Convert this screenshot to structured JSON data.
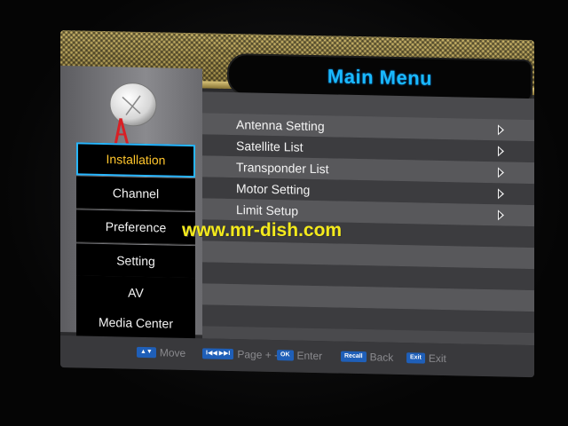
{
  "header": {
    "title": "Main Menu"
  },
  "sidebar": {
    "items": [
      {
        "label": "Installation",
        "active": true
      },
      {
        "label": "Channel"
      },
      {
        "label": "Preference"
      },
      {
        "label": "Setting"
      },
      {
        "label": "AV"
      },
      {
        "label": "Media Center"
      }
    ]
  },
  "submenu": {
    "items": [
      {
        "label": "Antenna Setting"
      },
      {
        "label": "Satellite List"
      },
      {
        "label": "Transponder List"
      },
      {
        "label": "Motor Setting"
      },
      {
        "label": "Limit Setup"
      }
    ]
  },
  "footer": {
    "hints": [
      {
        "key": "▲▼",
        "label": "Move"
      },
      {
        "key": "I◀◀ ▶▶I",
        "label": "Page + -"
      },
      {
        "key": "OK",
        "label": "Enter"
      },
      {
        "key": "Recall",
        "label": "Back"
      },
      {
        "key": "Exit",
        "label": "Exit"
      }
    ]
  },
  "watermark": "www.mr-dish.com",
  "colors": {
    "title": "#19b9ff",
    "active_item": "#ffc52c",
    "focus_border": "#27b6ff",
    "watermark": "#f4ea1c",
    "key_button": "#1f5fb8"
  },
  "icons": {
    "dish": "satellite-dish-icon",
    "arrow": "chevron-right-icon"
  }
}
